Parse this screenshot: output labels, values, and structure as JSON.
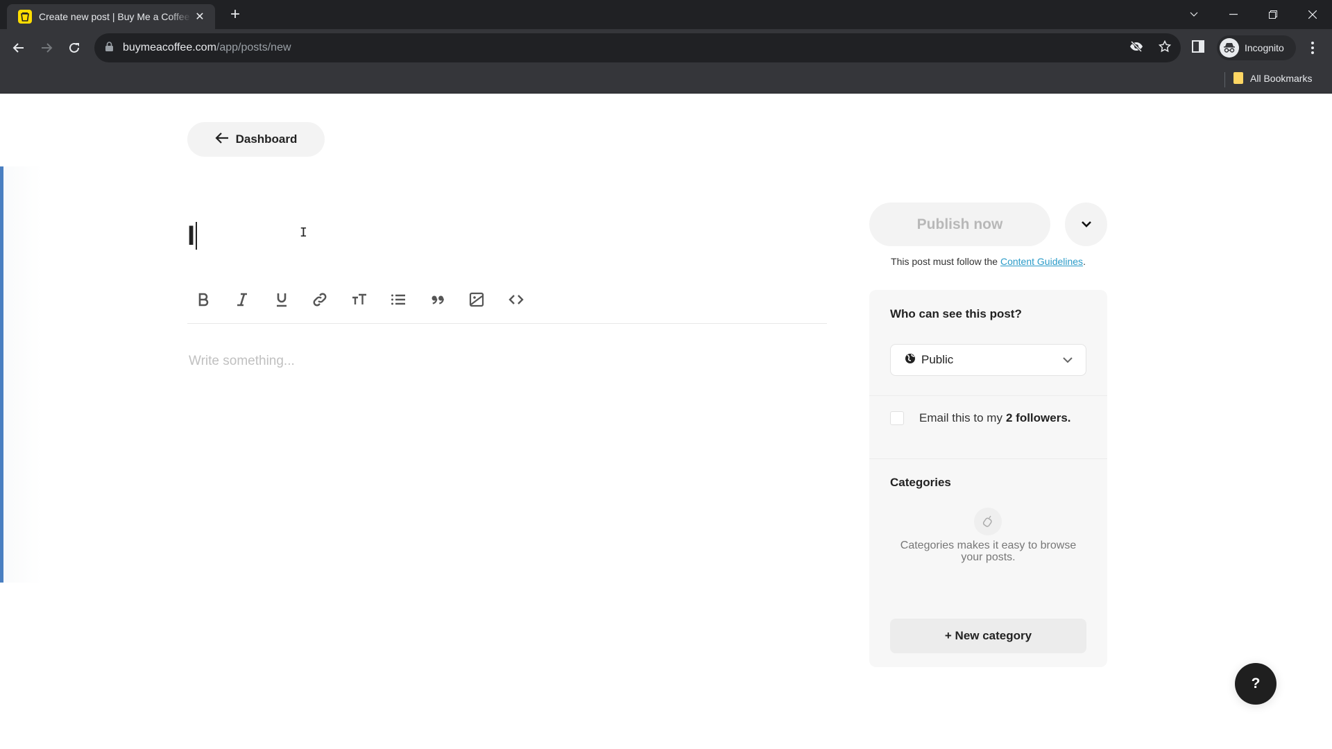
{
  "browser": {
    "tab_title": "Create new post | Buy Me a Coffee",
    "url_host": "buymeacoffee.com",
    "url_path": "/app/posts/new",
    "profile_label": "Incognito",
    "bookmarks_label": "All Bookmarks",
    "icons": [
      "back-icon",
      "forward-icon",
      "reload-icon",
      "lock-icon",
      "eye-off-icon",
      "star-icon",
      "side-panel-icon",
      "incognito-icon",
      "menu-icon"
    ]
  },
  "page": {
    "back_label": "Dashboard",
    "title_value": "I",
    "body_placeholder": "Write something...",
    "toolbar": [
      {
        "name": "bold",
        "icon": "bold-icon"
      },
      {
        "name": "italic",
        "icon": "italic-icon"
      },
      {
        "name": "underline",
        "icon": "underline-icon"
      },
      {
        "name": "link",
        "icon": "link-icon"
      },
      {
        "name": "text-size",
        "icon": "text-size-icon"
      },
      {
        "name": "bullet-list",
        "icon": "list-icon"
      },
      {
        "name": "quote",
        "icon": "quote-icon"
      },
      {
        "name": "image",
        "icon": "image-icon"
      },
      {
        "name": "code",
        "icon": "code-icon"
      }
    ],
    "accent_color": "#4a7fc1"
  },
  "sidebar": {
    "publish_label": "Publish now",
    "guidelines_prefix": "This post must follow the ",
    "guidelines_link": "Content Guidelines",
    "guidelines_suffix": ".",
    "visibility_heading": "Who can see this post?",
    "visibility_value": "Public",
    "email_prefix": "Email this to my",
    "email_count": "2 followers.",
    "email_checked": false,
    "categories_heading": "Categories",
    "categories_empty": "Categories makes it easy to browse your posts.",
    "new_category_label": "+ New category",
    "link_color": "#2a9bc8"
  },
  "help": {
    "label": "?"
  }
}
